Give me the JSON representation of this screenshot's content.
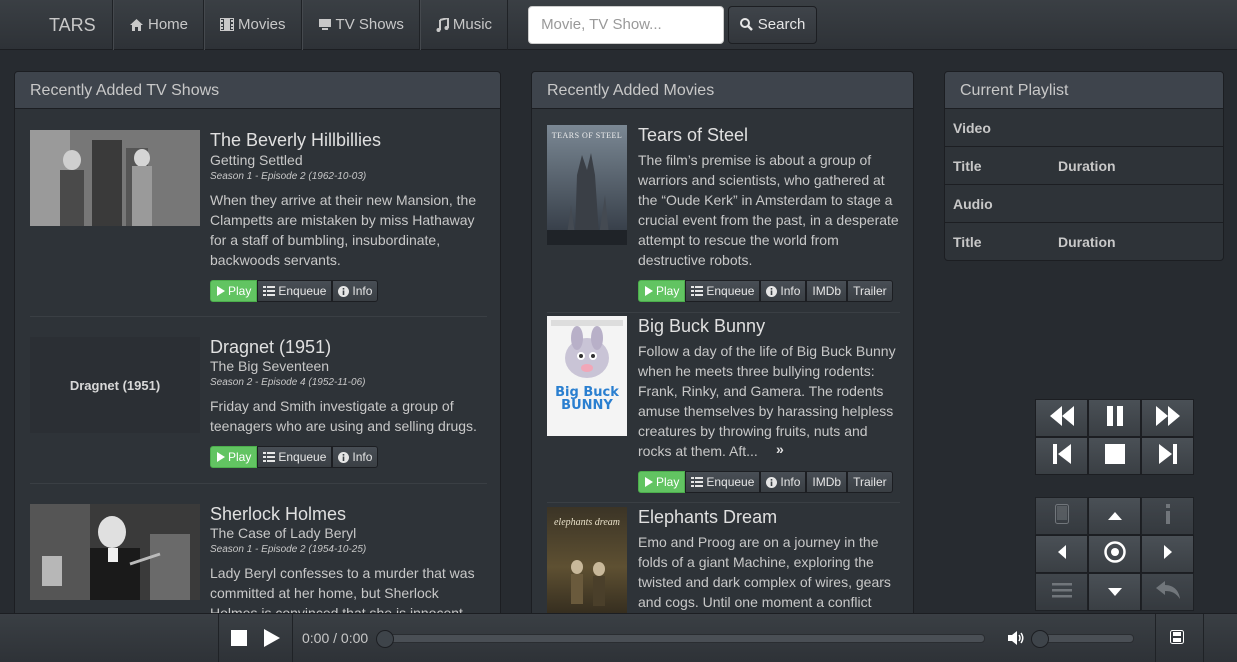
{
  "nav": {
    "brand": "TARS",
    "home": "Home",
    "movies": "Movies",
    "tv_shows": "TV Shows",
    "music": "Music",
    "search_placeholder": "Movie, TV Show...",
    "search_button": "Search"
  },
  "tv_panel": {
    "heading": "Recently Added TV Shows",
    "items": [
      {
        "title": "The Beverly Hillbillies",
        "episode_title": "Getting Settled",
        "episode_info": "Season 1 - Episode 2 (1962-10-03)",
        "description": "When they arrive at their new Mansion, the Clampetts are mistaken by miss Hathaway for a staff of bumbling, insubordinate, backwoods servants."
      },
      {
        "title": "Dragnet (1951)",
        "thumb_text": "Dragnet (1951)",
        "episode_title": "The Big Seventeen",
        "episode_info": "Season 2 - Episode 4 (1952-11-06)",
        "description": "Friday and Smith investigate a group of teenagers who are using and selling drugs."
      },
      {
        "title": "Sherlock Holmes",
        "episode_title": "The Case of Lady Beryl",
        "episode_info": "Season 1 - Episode 2 (1954-10-25)",
        "description": "Lady Beryl confesses to a murder that was committed at her home, but Sherlock Holmes is convinced that she is innocent."
      }
    ],
    "buttons": {
      "play": "Play",
      "enqueue": "Enqueue",
      "info": "Info"
    }
  },
  "movies_panel": {
    "heading": "Recently Added Movies",
    "items": [
      {
        "title": "Tears of Steel",
        "poster_text": "TEARS OF STEEL",
        "description": "The film’s premise is about a group of warriors and scientists, who gathered at the “Oude Kerk” in Amsterdam to stage a crucial event from the past, in a desperate attempt to rescue the world from destructive robots."
      },
      {
        "title": "Big Buck Bunny",
        "poster_text": "Big Buck BUNNY",
        "description": "Follow a day of the life of Big Buck Bunny when he meets three bullying rodents: Frank, Rinky, and Gamera. The rodents amuse themselves by harassing helpless creatures by throwing fruits, nuts and rocks at them. Aft...",
        "more": "»"
      },
      {
        "title": "Elephants Dream",
        "poster_text": "elephants dream",
        "description": "Emo and Proog are on a journey in the folds of a giant Machine, exploring the twisted and dark complex of wires, gears and cogs. Until one moment a conflict"
      }
    ],
    "buttons": {
      "play": "Play",
      "enqueue": "Enqueue",
      "info": "Info",
      "imdb": "IMDb",
      "trailer": "Trailer"
    }
  },
  "playlist": {
    "heading": "Current Playlist",
    "video_label": "Video",
    "audio_label": "Audio",
    "col_title": "Title",
    "col_duration": "Duration"
  },
  "player": {
    "time": "0:00 / 0:00",
    "progress": 0,
    "volume": 0
  }
}
